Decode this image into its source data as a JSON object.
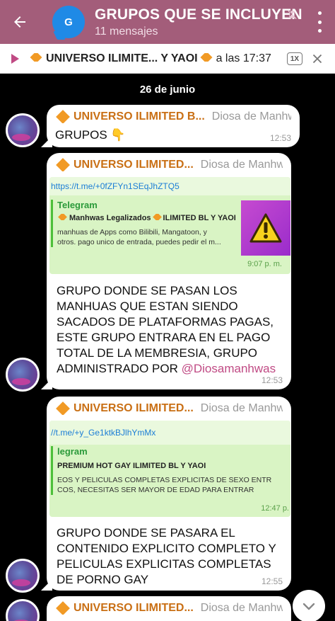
{
  "header": {
    "title": "GRUPOS QUE SE INCLUYEN",
    "subtitle": "11 mensajes",
    "avatar_letter": "G",
    "color": "#a35d7a"
  },
  "pinned": {
    "title": "UNIVERSO ILIMITE... Y YAOI",
    "time_text": "a las 17:37",
    "speed": "1X"
  },
  "date_separator": "26 de junio",
  "messages": [
    {
      "sender": "UNIVERSO ILIMITED B...",
      "role": "Diosa de Manhwas",
      "text": "GRUPOS 👇",
      "time": "12:53"
    },
    {
      "sender": "UNIVERSO ILIMITED...",
      "role": "Diosa de Manhwas",
      "preview": {
        "link": "https://t.me/+0fZFYn1SEqJhZTQ5",
        "site": "Telegram",
        "title": "Manhwas Legalizados",
        "title_suffix": "ILIMITED BL Y YAOI",
        "desc1": "manhuas de Apps como Bilibili, Mangatoon, y",
        "desc2": "otros. pago unico de entrada, puedes pedir el m...",
        "time": "9:07 p. m."
      },
      "text_lines": [
        "GRUPO DONDE SE PASAN LOS",
        "MANHUAS QUE ESTAN SIENDO",
        "SACADOS DE PLATAFORMAS PAGAS,",
        "ESTE GRUPO ENTRARA EN EL PAGO",
        "TOTAL DE LA MEMBRESIA, GRUPO",
        "ADMINISTRADO POR "
      ],
      "mention": "@Diosamanhwas",
      "time": "12:53"
    },
    {
      "sender": "UNIVERSO ILIMITED...",
      "role": "Diosa de Manhwas",
      "preview": {
        "link": "//t.me/+y_Ge1ktkBJlhYmMx",
        "site": "legram",
        "title": "PREMIUM HOT GAY ILIMITED BL Y YAOI",
        "desc1": "EOS Y PELICULAS COMPLETAS EXPLICITAS DE SEXO ENTR",
        "desc2": "COS, NECESITAS SER MAYOR DE EDAD PARA ENTRAR",
        "time": "12:47 p."
      },
      "text_lines": [
        "GRUPO DONDE SE PASARA EL",
        "CONTENIDO EXPLICITO COMPLETO Y",
        "PELICULAS EXPLICITAS COMPLETAS",
        "DE PORNO GAY"
      ],
      "time": "12:55"
    },
    {
      "sender": "UNIVERSO ILIMITED...",
      "role": "Diosa de Manhwas"
    }
  ],
  "icons": {
    "back": "arrow-left-icon",
    "mute": "bell-off-icon",
    "menu": "more-vertical-icon",
    "play": "play-icon",
    "close": "close-icon",
    "scroll": "chevron-down-icon",
    "diamond": "orange-diamond-icon",
    "warning": "warning-icon"
  }
}
